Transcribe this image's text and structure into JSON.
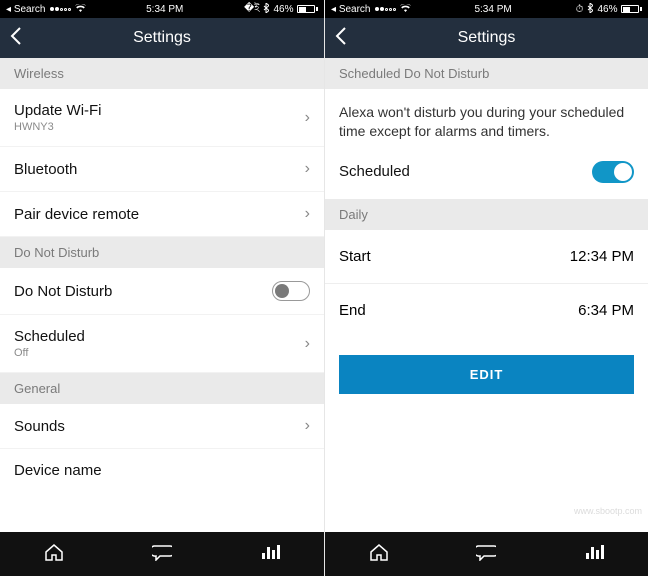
{
  "status": {
    "search": "Search",
    "time": "5:34 PM",
    "battery": "46%"
  },
  "left": {
    "title": "Settings",
    "sec_wireless": "Wireless",
    "wifi_title": "Update Wi-Fi",
    "wifi_sub": "HWNY3",
    "bluetooth": "Bluetooth",
    "pair": "Pair device remote",
    "sec_dnd": "Do Not Disturb",
    "dnd": "Do Not Disturb",
    "scheduled": "Scheduled",
    "scheduled_sub": "Off",
    "sec_general": "General",
    "sounds": "Sounds",
    "device_name": "Device name"
  },
  "right": {
    "title": "Settings",
    "sec_head": "Scheduled Do Not Disturb",
    "desc": "Alexa won't disturb you during your scheduled time except for alarms and timers.",
    "scheduled": "Scheduled",
    "sec_daily": "Daily",
    "start_label": "Start",
    "start_time": "12:34 PM",
    "end_label": "End",
    "end_time": "6:34 PM",
    "edit": "EDIT"
  }
}
